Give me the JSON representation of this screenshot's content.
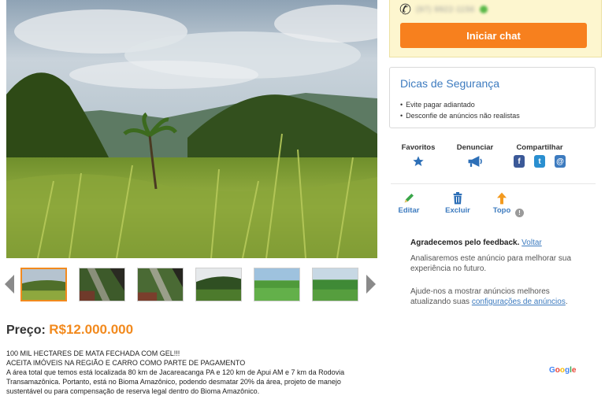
{
  "contact": {
    "phone_masked": "(97) 9922-1156",
    "chat_button": "Iniciar chat"
  },
  "tips": {
    "title": "Dicas de Segurança",
    "items": [
      "Evite pagar adiantado",
      "Desconfie de anúncios não realistas"
    ]
  },
  "actions": {
    "favorites": "Favoritos",
    "report": "Denunciar",
    "share": "Compartilhar"
  },
  "tools": {
    "edit": "Editar",
    "delete": "Excluir",
    "top": "Topo"
  },
  "feedback": {
    "title": "Agradecemos pelo feedback.",
    "back_link": "Voltar",
    "line1": "Analisaremos este anúncio para melhorar sua experiência no futuro.",
    "line2_text": "Ajude-nos a mostrar anúncios melhores atualizando suas ",
    "line2_link": "configurações de anúncios",
    "line2_end": "."
  },
  "price": {
    "label": "Preço:",
    "value": "R$12.000.000"
  },
  "description": {
    "line1": "100 MIL HECTARES DE MATA FECHADA COM GEL!!!",
    "line2": "ACEITA IMÓVEIS NA REGIÃO E CARRO COMO PARTE DE PAGAMENTO",
    "line3": "A área total que temos está localizada 80 km de Jacareacanga PA e 120 km de Apui AM e 7 km da Rodovia Transamazônica. Portanto, está no Bioma Amazônico, podendo desmatar 20% da área, projeto de manejo sustentável ou para compensação de reserva legal dentro do Bioma Amazônico."
  },
  "google": {
    "letters": [
      "G",
      "o",
      "o",
      "g",
      "l",
      "e"
    ],
    "colors": [
      "#4285f4",
      "#ea4335",
      "#fbbc05",
      "#4285f4",
      "#34a853",
      "#ea4335"
    ]
  },
  "colors": {
    "accent": "#f7801e",
    "link": "#3d7bbf",
    "contact_bg": "#fdf6cf"
  },
  "icons": {
    "phone": "phone-icon",
    "favorite": "star-icon",
    "report": "megaphone-icon",
    "facebook": "facebook-icon",
    "twitter": "twitter-icon",
    "email": "at-icon",
    "edit": "pencil-icon",
    "delete": "trash-icon",
    "top": "arrow-up-icon",
    "info": "info-icon"
  }
}
